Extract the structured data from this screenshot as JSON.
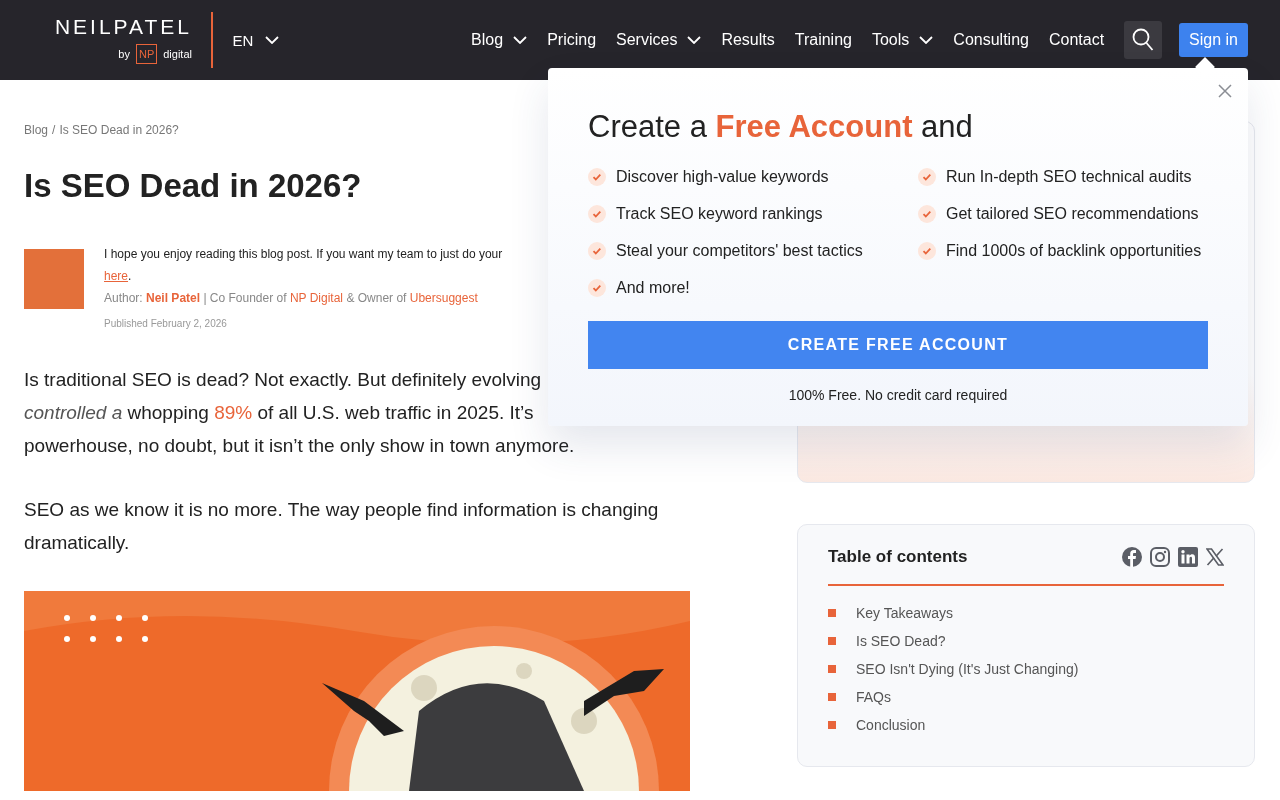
{
  "header": {
    "logo": {
      "wordmark": "NEILPATEL",
      "by": "by",
      "badge": "NP",
      "brand": "digital"
    },
    "language": "EN",
    "nav": [
      {
        "label": "Blog",
        "dropdown": true
      },
      {
        "label": "Pricing",
        "dropdown": false
      },
      {
        "label": "Services",
        "dropdown": true
      },
      {
        "label": "Results",
        "dropdown": false
      },
      {
        "label": "Training",
        "dropdown": false
      },
      {
        "label": "Tools",
        "dropdown": true
      },
      {
        "label": "Consulting",
        "dropdown": false
      },
      {
        "label": "Contact",
        "dropdown": false
      }
    ],
    "sign_in": "Sign in"
  },
  "breadcrumb": {
    "items": [
      "Blog",
      "Is SEO Dead in 2026?"
    ],
    "separator": "/"
  },
  "title": "Is SEO Dead in 2026?",
  "intro": {
    "message": "I hope you enjoy reading this blog post. If you want my team to just do your",
    "link": "here",
    "tail": ".",
    "author": [
      {
        "kind": "text",
        "text": "Author: "
      },
      {
        "kind": "strong-link",
        "text": "Neil Patel"
      },
      {
        "kind": "text",
        "text": " | Co Founder of "
      },
      {
        "kind": "link",
        "text": "NP Digital"
      },
      {
        "kind": "text",
        "text": " & Owner of "
      },
      {
        "kind": "link",
        "text": "Ubersuggest"
      }
    ],
    "published": "Published February 2, 2026"
  },
  "paragraphs": [
    {
      "lines": [
        [
          {
            "kind": "text",
            "text": "Is traditional SEO is dead? Not exactly. But definitely evolving"
          }
        ],
        [
          {
            "kind": "italic",
            "text": "controlled a"
          },
          {
            "kind": "text",
            "text": " whopping "
          },
          {
            "kind": "highlight",
            "text": "89%"
          },
          {
            "kind": "text",
            "text": " of all U.S. web traffic in 2025. It’s"
          }
        ],
        [
          {
            "kind": "text",
            "text": "powerhouse, no doubt, but it isn’t the only show in town anymore."
          }
        ]
      ]
    },
    {
      "lines": [
        [
          {
            "kind": "text",
            "text": "SEO as we know it is no more. The way people find information is changing"
          }
        ],
        [
          {
            "kind": "text",
            "text": "dramatically."
          }
        ]
      ]
    }
  ],
  "popup": {
    "title": [
      {
        "kind": "text",
        "text": "Create a "
      },
      {
        "kind": "accent",
        "text": "Free Account"
      },
      {
        "kind": "text",
        "text": " and"
      }
    ],
    "features": [
      "Discover high-value keywords",
      "Track SEO keyword rankings",
      "Steal your competitors' best tactics",
      "And more!",
      "Run In-depth SEO technical audits",
      "Get tailored SEO recommendations",
      "Find 1000s of backlink opportunities"
    ],
    "button": "CREATE FREE ACCOUNT",
    "note": "100% Free. No credit card required"
  },
  "toc": {
    "title": "Table of contents",
    "items": [
      "Key Takeaways",
      "Is SEO Dead?",
      "SEO Isn't Dying (It's Just Changing)",
      "FAQs",
      "Conclusion"
    ]
  }
}
